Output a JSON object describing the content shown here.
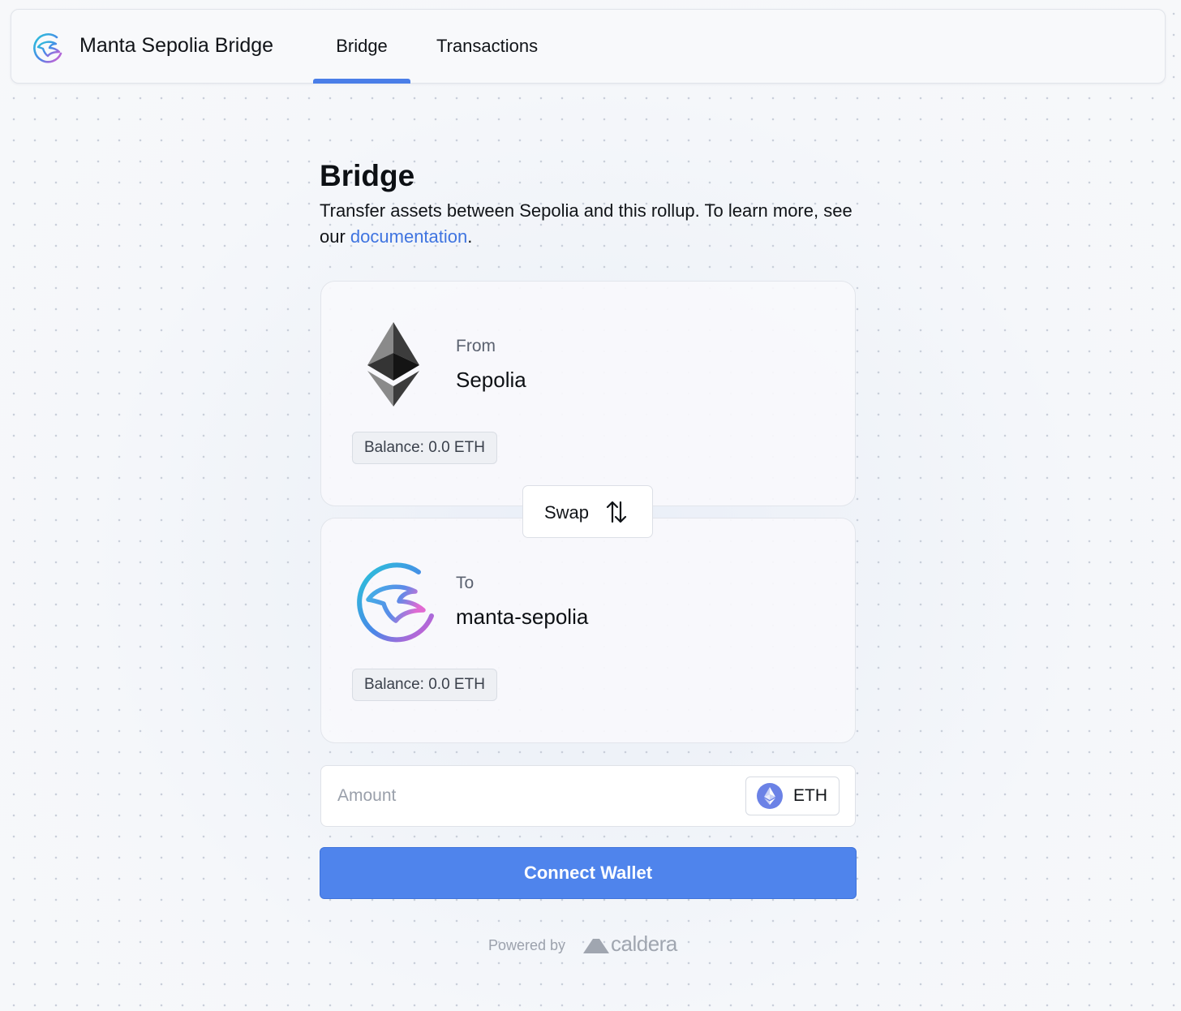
{
  "header": {
    "brand_title": "Manta Sepolia Bridge",
    "tabs": [
      {
        "label": "Bridge",
        "active": true
      },
      {
        "label": "Transactions",
        "active": false
      }
    ]
  },
  "main": {
    "title": "Bridge",
    "subtitle_text": "Transfer assets between Sepolia and this rollup. To learn more, see our ",
    "subtitle_link": "documentation",
    "subtitle_end": ".",
    "from": {
      "direction_label": "From",
      "chain_name": "Sepolia",
      "balance": "Balance: 0.0 ETH",
      "icon": "ethereum-icon"
    },
    "swap": {
      "label": "Swap",
      "icon": "swap-arrows-icon"
    },
    "to": {
      "direction_label": "To",
      "chain_name": "manta-sepolia",
      "balance": "Balance: 0.0 ETH",
      "icon": "manta-logo-icon"
    },
    "amount": {
      "placeholder": "Amount",
      "value": "",
      "token": "ETH",
      "token_icon": "eth-token-icon"
    },
    "connect_button": "Connect Wallet"
  },
  "footer": {
    "powered_by": "Powered by",
    "brand": "caldera"
  },
  "colors": {
    "accent": "#4f84ec",
    "link": "#3f74e0",
    "eth_token": "#6b82e6"
  }
}
